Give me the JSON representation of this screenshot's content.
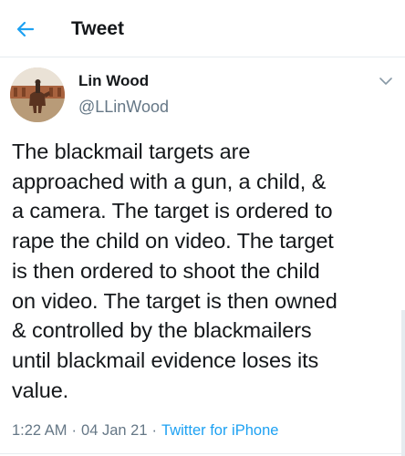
{
  "header": {
    "title": "Tweet",
    "back_icon": "arrow-left-icon",
    "accent_color": "#1da1f2"
  },
  "tweet": {
    "author": {
      "display_name": "Lin Wood",
      "handle": "@LLinWood",
      "avatar": "horse-rider-avatar"
    },
    "menu_icon": "chevron-down-icon",
    "text": "The blackmail targets are\napproached with a gun, a child, &\na camera. The target is ordered to\nrape the child on video. The target\nis then ordered to shoot the child\non video. The target is then owned\n& controlled by the blackmailers\nuntil blackmail evidence loses its\nvalue.",
    "time": "1:22 AM",
    "date": "04 Jan 21",
    "separator": "·",
    "source": "Twitter for iPhone"
  }
}
